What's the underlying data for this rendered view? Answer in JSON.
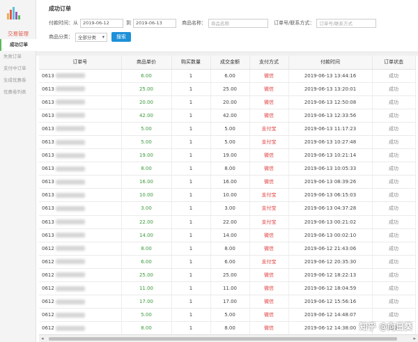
{
  "sidebar": {
    "group": "交易管理",
    "items": [
      {
        "label": "成功订单",
        "active": true
      },
      {
        "label": "失败订单",
        "active": false
      },
      {
        "label": "支付中订单",
        "active": false
      },
      {
        "label": "生成优惠卷",
        "active": false
      },
      {
        "label": "优惠卷列表",
        "active": false
      }
    ]
  },
  "page": {
    "title": "成功订单"
  },
  "filters": {
    "time_label": "付款时间：从",
    "date_from": "2019-06-12",
    "to_label": "到",
    "date_to": "2019-06-13",
    "product_label": "商品名称：",
    "product_placeholder": "商品名称",
    "order_label": "订单号/联系方式：",
    "order_placeholder": "订单号/联系方式",
    "category_label": "商品分类：",
    "category_value": "全部分类",
    "search_button": "搜索"
  },
  "table": {
    "columns": [
      "订单号",
      "商品单价",
      "购买数量",
      "成交金额",
      "支付方式",
      "付款时间",
      "订单状态"
    ],
    "rows": [
      {
        "id": "0613",
        "price": "6.00",
        "qty": "1",
        "amount": "6.00",
        "pay": "微信",
        "time": "2019-06-13 13:44:16",
        "status": "成功"
      },
      {
        "id": "0613",
        "price": "25.00",
        "qty": "1",
        "amount": "25.00",
        "pay": "微信",
        "time": "2019-06-13 13:20:01",
        "status": "成功"
      },
      {
        "id": "0613",
        "price": "20.00",
        "qty": "1",
        "amount": "20.00",
        "pay": "微信",
        "time": "2019-06-13 12:50:08",
        "status": "成功"
      },
      {
        "id": "0613",
        "price": "42.00",
        "qty": "1",
        "amount": "42.00",
        "pay": "微信",
        "time": "2019-06-13 12:33:56",
        "status": "成功"
      },
      {
        "id": "0613",
        "price": "5.00",
        "qty": "1",
        "amount": "5.00",
        "pay": "支付宝",
        "time": "2019-06-13 11:17:23",
        "status": "成功"
      },
      {
        "id": "0613",
        "price": "5.00",
        "qty": "1",
        "amount": "5.00",
        "pay": "支付宝",
        "time": "2019-06-13 10:27:48",
        "status": "成功"
      },
      {
        "id": "0613",
        "price": "19.00",
        "qty": "1",
        "amount": "19.00",
        "pay": "微信",
        "time": "2019-06-13 10:21:14",
        "status": "成功"
      },
      {
        "id": "0613",
        "price": "8.00",
        "qty": "1",
        "amount": "8.00",
        "pay": "微信",
        "time": "2019-06-13 10:05:33",
        "status": "成功"
      },
      {
        "id": "0613",
        "price": "16.00",
        "qty": "1",
        "amount": "16.00",
        "pay": "微信",
        "time": "2019-06-13 08:39:26",
        "status": "成功"
      },
      {
        "id": "0613",
        "price": "10.00",
        "qty": "1",
        "amount": "10.00",
        "pay": "支付宝",
        "time": "2019-06-13 06:15:03",
        "status": "成功"
      },
      {
        "id": "0613",
        "price": "3.00",
        "qty": "1",
        "amount": "3.00",
        "pay": "支付宝",
        "time": "2019-06-13 04:37:28",
        "status": "成功"
      },
      {
        "id": "0613",
        "price": "22.00",
        "qty": "1",
        "amount": "22.00",
        "pay": "支付宝",
        "time": "2019-06-13 00:21:02",
        "status": "成功"
      },
      {
        "id": "0613",
        "price": "14.00",
        "qty": "1",
        "amount": "14.00",
        "pay": "微信",
        "time": "2019-06-13 00:02:10",
        "status": "成功"
      },
      {
        "id": "0612",
        "price": "8.00",
        "qty": "1",
        "amount": "8.00",
        "pay": "微信",
        "time": "2019-06-12 21:43:06",
        "status": "成功"
      },
      {
        "id": "0612",
        "price": "6.00",
        "qty": "1",
        "amount": "6.00",
        "pay": "支付宝",
        "time": "2019-06-12 20:35:30",
        "status": "成功"
      },
      {
        "id": "0612",
        "price": "25.00",
        "qty": "1",
        "amount": "25.00",
        "pay": "微信",
        "time": "2019-06-12 18:22:13",
        "status": "成功"
      },
      {
        "id": "0612",
        "price": "11.00",
        "qty": "1",
        "amount": "11.00",
        "pay": "微信",
        "time": "2019-06-12 18:04:59",
        "status": "成功"
      },
      {
        "id": "0612",
        "price": "17.00",
        "qty": "1",
        "amount": "17.00",
        "pay": "微信",
        "time": "2019-06-12 15:56:16",
        "status": "成功"
      },
      {
        "id": "0612",
        "price": "5.00",
        "qty": "1",
        "amount": "5.00",
        "pay": "微信",
        "time": "2019-06-12 14:48:07",
        "status": "成功"
      },
      {
        "id": "0612",
        "price": "8.00",
        "qty": "1",
        "amount": "8.00",
        "pay": "微信",
        "time": "2019-06-12 14:38:00",
        "status": "成功"
      }
    ]
  },
  "watermark": "知乎 @向日葵",
  "colors": {
    "accent_red": "#e05a4e",
    "price_green": "#3a9a3a",
    "pay_red": "#e03c3c",
    "search_blue": "#1e90d8"
  }
}
